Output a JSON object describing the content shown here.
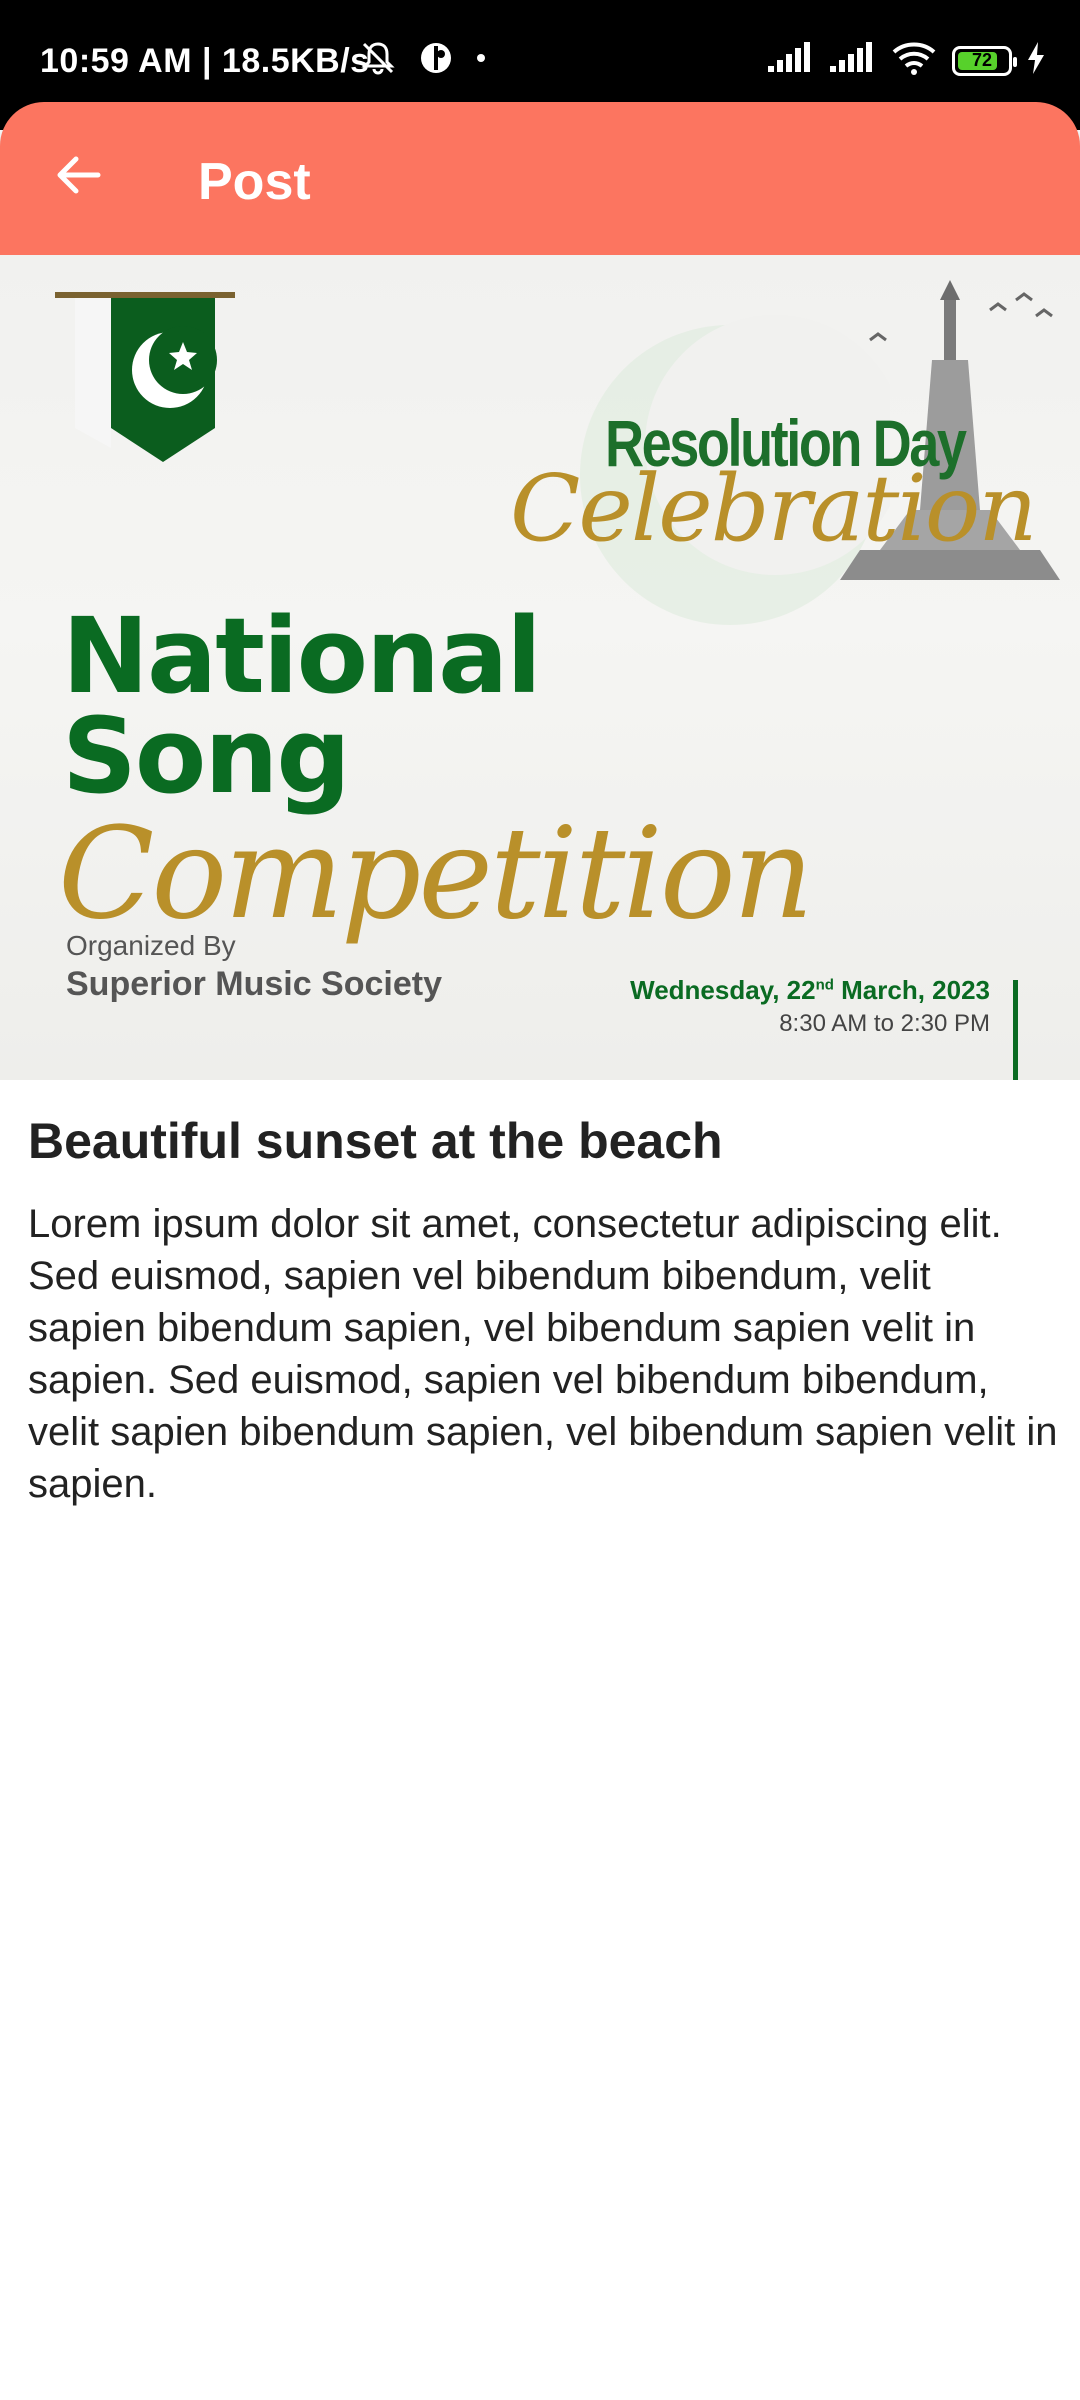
{
  "status_bar": {
    "time_speed": "10:59 AM | 18.5KB/s",
    "battery_level": "72",
    "icons": [
      "mute-icon",
      "vpn-icon",
      "dot-icon",
      "signal-icon",
      "signal-icon",
      "wifi-icon",
      "battery-icon",
      "charging-icon"
    ]
  },
  "app_bar": {
    "title": "Post",
    "back_icon": "arrow-left-icon",
    "color": "#fc7560"
  },
  "hero": {
    "badge_line1": "Resolution Day",
    "badge_line2": "Celebration",
    "title_line1": "National",
    "title_line2": "Song",
    "title_script": "Competition",
    "organized_by": "Organized By",
    "organizer": "Superior Music Society",
    "date_day": "Wednesday, 22",
    "date_suffix": "nd",
    "date_rest": " March, 2023",
    "time": "8:30 AM to 2:30 PM"
  },
  "post": {
    "title": "Beautiful sunset at the beach",
    "body": "Lorem ipsum dolor sit amet, consectetur adipiscing elit. Sed euismod, sapien vel bibendum bibendum, velit sapien bibendum sapien, vel bibendum sapien velit in sapien. Sed euismod, sapien vel bibendum bibendum, velit sapien bibendum sapien, vel bibendum sapien velit in sapien."
  }
}
